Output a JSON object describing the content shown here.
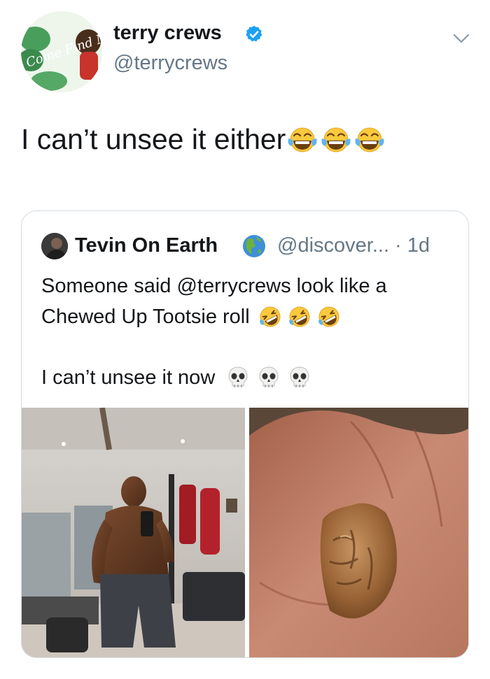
{
  "tweet": {
    "author": {
      "display_name": "terry crews",
      "handle": "@terrycrews",
      "verified": true,
      "avatar_icon": "avatar-comefindme-illustration",
      "avatar_text": "Come Find Me"
    },
    "text": "I can’t unsee it either",
    "emojis": [
      "face-with-tears-of-joy",
      "face-with-tears-of-joy",
      "face-with-tears-of-joy"
    ],
    "menu_icon": "chevron-down-icon"
  },
  "quoted_tweet": {
    "author": {
      "display_name": "Tevin On Earth",
      "name_emoji": "globe-americas",
      "handle_time": "@discover... · 1d"
    },
    "line1": "Someone said @terrycrews look like a",
    "line2": "Chewed Up Tootsie roll",
    "line2_emojis": [
      "rolling-on-the-floor-laughing",
      "rolling-on-the-floor-laughing",
      "rolling-on-the-floor-laughing"
    ],
    "line3": "I can’t unsee it now",
    "line3_emojis": [
      "skull",
      "skull",
      "skull"
    ],
    "media": [
      "gym-mirror-selfie-photo",
      "chewed-tootsie-roll-in-hand-photo"
    ]
  },
  "colors": {
    "text": "#14171a",
    "secondary": "#657786",
    "verified_blue": "#1da1f2",
    "border": "#d5dce1"
  }
}
